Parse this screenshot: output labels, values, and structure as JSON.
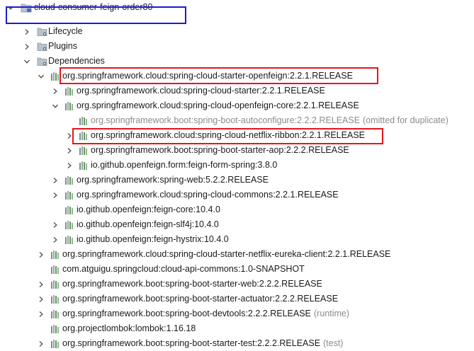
{
  "tree": {
    "root": {
      "label": "cloud-consumer-feign-order80",
      "expanded": true
    },
    "rows": [
      {
        "label": "Lifecycle",
        "icon": "folder-gear-icon",
        "expanded": false
      },
      {
        "label": "Plugins",
        "icon": "folder-gear-icon",
        "expanded": false
      },
      {
        "label": "Dependencies",
        "icon": "folder-gear-icon",
        "expanded": true
      },
      {
        "label": "org.springframework.cloud:spring-cloud-starter-openfeign:2.2.1.RELEASE",
        "icon": "library-icon",
        "expanded": true
      },
      {
        "label": "org.springframework.cloud:spring-cloud-starter:2.2.1.RELEASE",
        "icon": "library-icon",
        "expanded": false
      },
      {
        "label": "org.springframework.cloud:spring-cloud-openfeign-core:2.2.1.RELEASE",
        "icon": "library-icon",
        "expanded": true
      },
      {
        "label": "org.springframework.boot:spring-boot-autoconfigure:2.2.2.RELEASE",
        "extra": "(omitted for duplicate)",
        "icon": "library-icon",
        "dimmed": true
      },
      {
        "label": "org.springframework.cloud:spring-cloud-netflix-ribbon:2.2.1.RELEASE",
        "icon": "library-icon",
        "expanded": false
      },
      {
        "label": "org.springframework.boot:spring-boot-starter-aop:2.2.2.RELEASE",
        "icon": "library-icon",
        "expanded": false
      },
      {
        "label": "io.github.openfeign.form:feign-form-spring:3.8.0",
        "icon": "library-icon",
        "expanded": false
      },
      {
        "label": "org.springframework:spring-web:5.2.2.RELEASE",
        "icon": "library-icon",
        "expanded": false
      },
      {
        "label": "org.springframework.cloud:spring-cloud-commons:2.2.1.RELEASE",
        "icon": "library-icon",
        "expanded": false
      },
      {
        "label": "io.github.openfeign:feign-core:10.4.0",
        "icon": "library-icon"
      },
      {
        "label": "io.github.openfeign:feign-slf4j:10.4.0",
        "icon": "library-icon",
        "expanded": false
      },
      {
        "label": "io.github.openfeign:feign-hystrix:10.4.0",
        "icon": "library-icon",
        "expanded": false
      },
      {
        "label": "org.springframework.cloud:spring-cloud-starter-netflix-eureka-client:2.2.1.RELEASE",
        "icon": "library-icon",
        "expanded": false
      },
      {
        "label": "com.atguigu.springcloud:cloud-api-commons:1.0-SNAPSHOT",
        "icon": "library-icon"
      },
      {
        "label": "org.springframework.boot:spring-boot-starter-web:2.2.2.RELEASE",
        "icon": "library-icon",
        "expanded": false
      },
      {
        "label": "org.springframework.boot:spring-boot-starter-actuator:2.2.2.RELEASE",
        "icon": "library-icon",
        "expanded": false
      },
      {
        "label": "org.springframework.boot:spring-boot-devtools:2.2.2.RELEASE",
        "extra": "(runtime)",
        "icon": "library-icon",
        "expanded": false
      },
      {
        "label": "org.projectlombok:lombok:1.16.18",
        "icon": "library-icon"
      },
      {
        "label": "org.springframework.boot:spring-boot-starter-test:2.2.2.RELEASE",
        "extra": "(test)",
        "icon": "library-icon",
        "expanded": false
      }
    ]
  },
  "colors": {
    "highlight_box": "#e8141c",
    "root_box": "#1b1bd6",
    "dim_text": "#8c8c8c"
  }
}
